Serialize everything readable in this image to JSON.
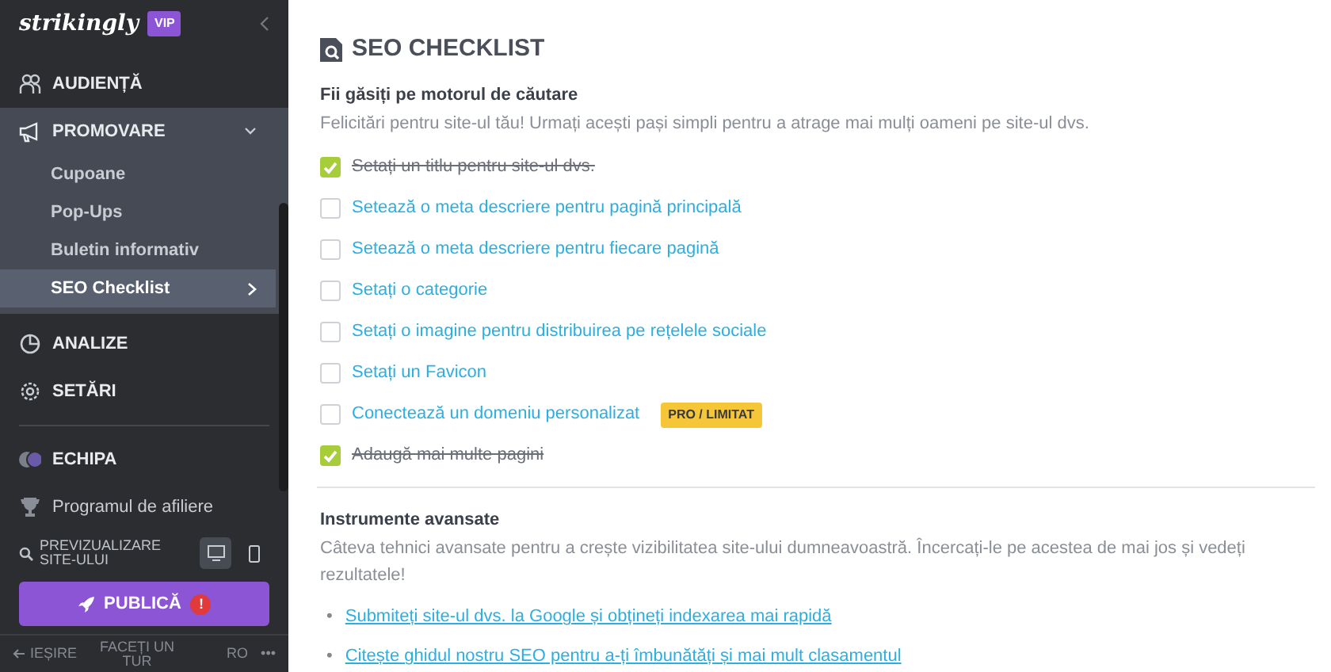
{
  "sidebar": {
    "logo": "strikingly",
    "plan_badge": "VIP",
    "nav": [
      {
        "kind": "audience",
        "label": "AUDIENȚĂ"
      },
      {
        "kind": "promote",
        "label": "PROMOVARE",
        "expanded": true,
        "children": [
          {
            "label": "Cupoane",
            "selected": false
          },
          {
            "label": "Pop-Ups",
            "selected": false
          },
          {
            "label": "Buletin informativ",
            "selected": false
          },
          {
            "label": "SEO Checklist",
            "selected": true
          }
        ]
      },
      {
        "kind": "analytics",
        "label": "ANALIZE"
      },
      {
        "kind": "settings",
        "label": "SETĂRI"
      },
      {
        "kind": "team",
        "label": "ECHIPA"
      },
      {
        "kind": "affiliate",
        "label": "Programul de afiliere"
      }
    ],
    "preview": {
      "label": "PREVIZUALIZARE SITE-ULUI",
      "devices": [
        {
          "kind": "desktop",
          "selected": true
        },
        {
          "kind": "mobile",
          "selected": false
        }
      ]
    },
    "publish": {
      "label": "PUBLICĂ",
      "alert": "!"
    },
    "footer": {
      "exit": "IEȘIRE",
      "tour": "FACEȚI UN TUR",
      "language": "RO",
      "more": "•••"
    }
  },
  "main": {
    "title": "SEO CHECKLIST",
    "section": {
      "heading": "Fii găsiți pe motorul de căutare",
      "description": "Felicitări pentru site-ul tău! Urmați acești pași simpli pentru a atrage mai mulți oameni pe site-ul dvs.",
      "items": [
        {
          "label": "Setați un titlu pentru site-ul dvs.",
          "checked": true
        },
        {
          "label": "Setează o meta descriere pentru pagină principală",
          "checked": false
        },
        {
          "label": "Setează o meta descriere pentru fiecare pagină",
          "checked": false
        },
        {
          "label": "Setați o categorie",
          "checked": false
        },
        {
          "label": "Setați o imagine pentru distribuirea pe rețelele sociale",
          "checked": false
        },
        {
          "label": "Setați un Favicon",
          "checked": false
        },
        {
          "label": "Conectează un domeniu personalizat",
          "checked": false,
          "badge": "PRO / LIMITAT"
        },
        {
          "label": "Adaugă mai multe pagini",
          "checked": true
        }
      ]
    },
    "advanced": {
      "heading": "Instrumente avansate",
      "description": "Câteva tehnici avansate pentru a crește vizibilitatea site-ului dumneavoastră. Încercați-le pe acestea de mai jos și vedeți rezultatele!",
      "marker": "•",
      "links": [
        "Submiteți site-ul dvs. la Google și obțineți indexarea mai rapidă",
        "Citește ghidul nostru SEO pentru a-ți îmbunătăți și mai mult clasamentul"
      ]
    }
  }
}
